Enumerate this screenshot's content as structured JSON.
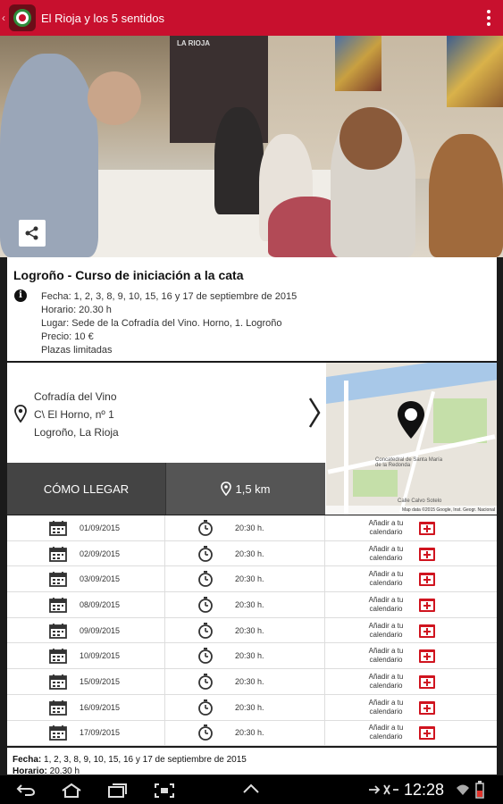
{
  "appbar": {
    "title": "El Rioja y los 5 sentidos",
    "colors": {
      "primary": "#c8102e"
    }
  },
  "hero": {
    "banner_text": "LA RIOJA"
  },
  "event": {
    "title": "Logroño - Curso de iniciación a la cata",
    "details": [
      "Fecha: 1, 2, 3, 8, 9, 10, 15, 16 y 17 de septiembre de 2015",
      "Horario: 20.30 h",
      "Lugar: Sede de la Cofradía del Vino. Horno, 1. Logroño",
      "Precio: 10 €",
      "Plazas limitadas"
    ]
  },
  "location": {
    "lines": [
      "Cofradía del Vino",
      "C\\ El Horno, nº 1",
      "Logroño, La Rioja"
    ],
    "map": {
      "labels": [
        "Concatedral de Santa María de la Redonda",
        "Calle Calvo Sotelo",
        "Map data ©2015 Google, Inst. Geogr. Nacional"
      ]
    }
  },
  "actions": {
    "directions_label": "CÓMO LLEGAR",
    "distance_label": "1,5 km"
  },
  "sessions": [
    {
      "date": "01/09/2015",
      "time": "20:30 h.",
      "add": "Añadir a tu calendario"
    },
    {
      "date": "02/09/2015",
      "time": "20:30 h.",
      "add": "Añadir a tu calendario"
    },
    {
      "date": "03/09/2015",
      "time": "20:30 h.",
      "add": "Añadir a tu calendario"
    },
    {
      "date": "08/09/2015",
      "time": "20:30 h.",
      "add": "Añadir a tu calendario"
    },
    {
      "date": "09/09/2015",
      "time": "20:30 h.",
      "add": "Añadir a tu calendario"
    },
    {
      "date": "10/09/2015",
      "time": "20:30 h.",
      "add": "Añadir a tu calendario"
    },
    {
      "date": "15/09/2015",
      "time": "20:30 h.",
      "add": "Añadir a tu calendario"
    },
    {
      "date": "16/09/2015",
      "time": "20:30 h.",
      "add": "Añadir a tu calendario"
    },
    {
      "date": "17/09/2015",
      "time": "20:30 h.",
      "add": "Añadir a tu calendario"
    }
  ],
  "bottom": {
    "fecha_label": "Fecha:",
    "fecha_value": " 1, 2, 3, 8, 9, 10, 15, 16 y 17 de septiembre de 2015",
    "horario_label": "Horario:",
    "horario_value": " 20.30 h"
  },
  "statusbar": {
    "time": "12:28"
  }
}
